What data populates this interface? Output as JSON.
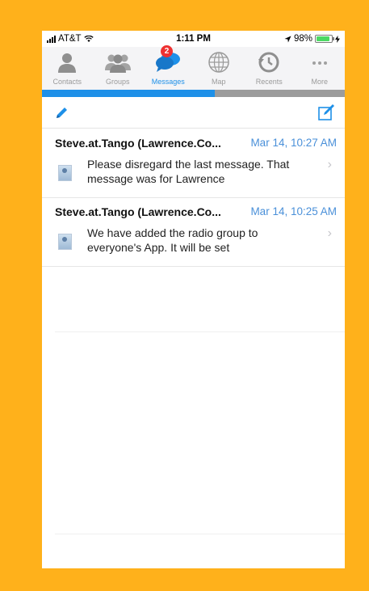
{
  "status_bar": {
    "carrier": "AT&T",
    "time": "1:11 PM",
    "battery": "98%",
    "battery_level": 0.98
  },
  "tabs": [
    {
      "label": "Contacts",
      "icon": "contacts-icon"
    },
    {
      "label": "Groups",
      "icon": "groups-icon"
    },
    {
      "label": "Messages",
      "icon": "messages-icon",
      "badge": "2",
      "active": true
    },
    {
      "label": "Map",
      "icon": "map-icon"
    },
    {
      "label": "Recents",
      "icon": "recents-icon"
    },
    {
      "label": "More",
      "icon": "more-icon"
    }
  ],
  "progress": 0.57,
  "toolbar": {
    "left_icon": "pencil-icon",
    "right_icon": "compose-icon"
  },
  "messages": [
    {
      "sender": "Steve.at.Tango (Lawrence.Co...",
      "time": "Mar 14, 10:27 AM",
      "preview": "Please disregard the last message. That message was for Lawrence"
    },
    {
      "sender": "Steve.at.Tango (Lawrence.Co...",
      "time": "Mar 14, 10:25 AM",
      "preview": "We have added the radio group to everyone's App. It will be set"
    }
  ],
  "colors": {
    "accent": "#1E90E8",
    "badge": "#EE3131",
    "frame": "#FFB11B",
    "time_text": "#4A90D9"
  }
}
